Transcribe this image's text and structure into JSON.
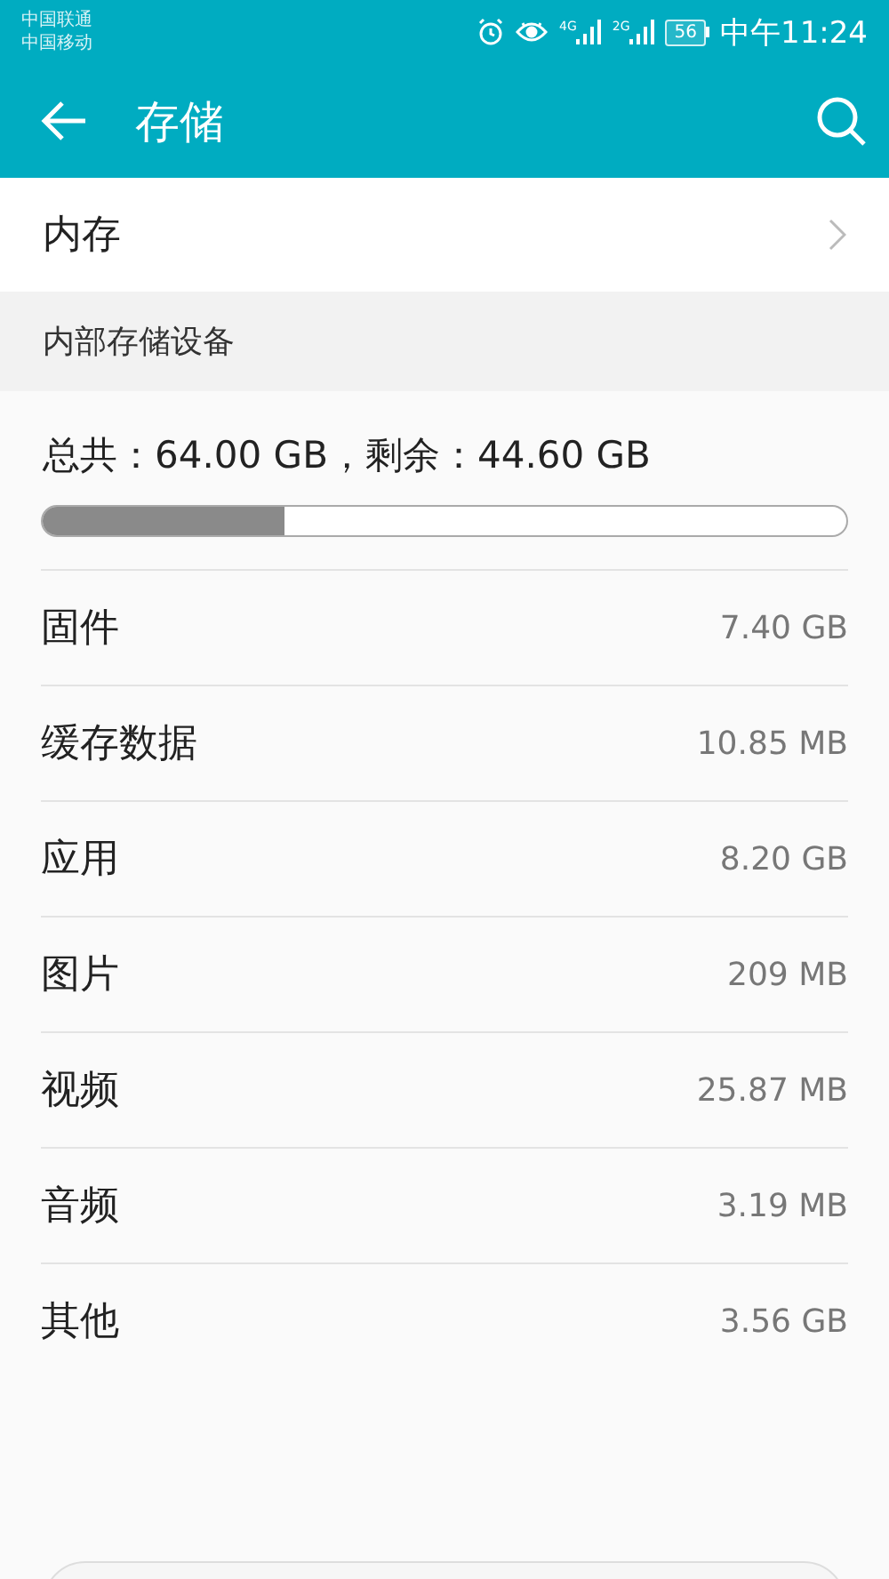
{
  "status_bar": {
    "carriers": [
      "中国联通",
      "中国移动"
    ],
    "signals": [
      {
        "network": "4G"
      },
      {
        "network": "2G"
      }
    ],
    "battery": "56",
    "time": "中午11:24"
  },
  "app_bar": {
    "title": "存储"
  },
  "menu_item": {
    "label": "内存"
  },
  "section": {
    "title": "内部存储设备",
    "summary": "总共：64.00 GB，剩余：44.60 GB",
    "usage": {
      "level": 0.3
    },
    "categories": [
      {
        "name": "固件",
        "size": "7.40 GB"
      },
      {
        "name": "缓存数据",
        "size": "10.85 MB"
      },
      {
        "name": "应用",
        "size": "8.20 GB"
      },
      {
        "name": "图片",
        "size": "209 MB"
      },
      {
        "name": "视频",
        "size": "25.87 MB"
      },
      {
        "name": "音频",
        "size": "3.19 MB"
      },
      {
        "name": "其他",
        "size": "3.56 GB"
      }
    ]
  }
}
